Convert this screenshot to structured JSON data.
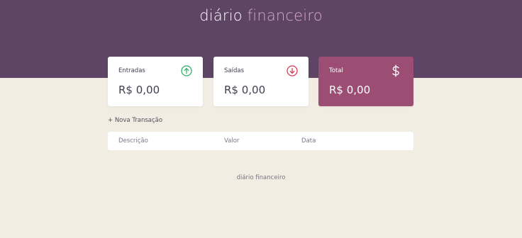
{
  "header": {
    "logo_main": "diário",
    "logo_accent": "financeiro"
  },
  "cards": [
    {
      "label": "Entradas",
      "amount": "R$ 0,00",
      "icon": "arrow-up-circle-icon",
      "icon_color": "#2bb36b"
    },
    {
      "label": "Saídas",
      "amount": "R$ 0,00",
      "icon": "arrow-down-circle-icon",
      "icon_color": "#d23a55"
    },
    {
      "label": "Total",
      "amount": "R$ 0,00",
      "icon": "dollar-icon",
      "icon_color": "#ffffff"
    }
  ],
  "transactions": {
    "new_label": "+ Nova Transação",
    "columns": [
      "Descrição",
      "Valor",
      "Data"
    ],
    "rows": []
  },
  "footer": {
    "text": "diário financeiro"
  },
  "colors": {
    "header_bg": "#5e4565",
    "page_bg": "#f2ede2",
    "total_card_bg": "#9c4d73",
    "accent": "#d9a7cc"
  }
}
